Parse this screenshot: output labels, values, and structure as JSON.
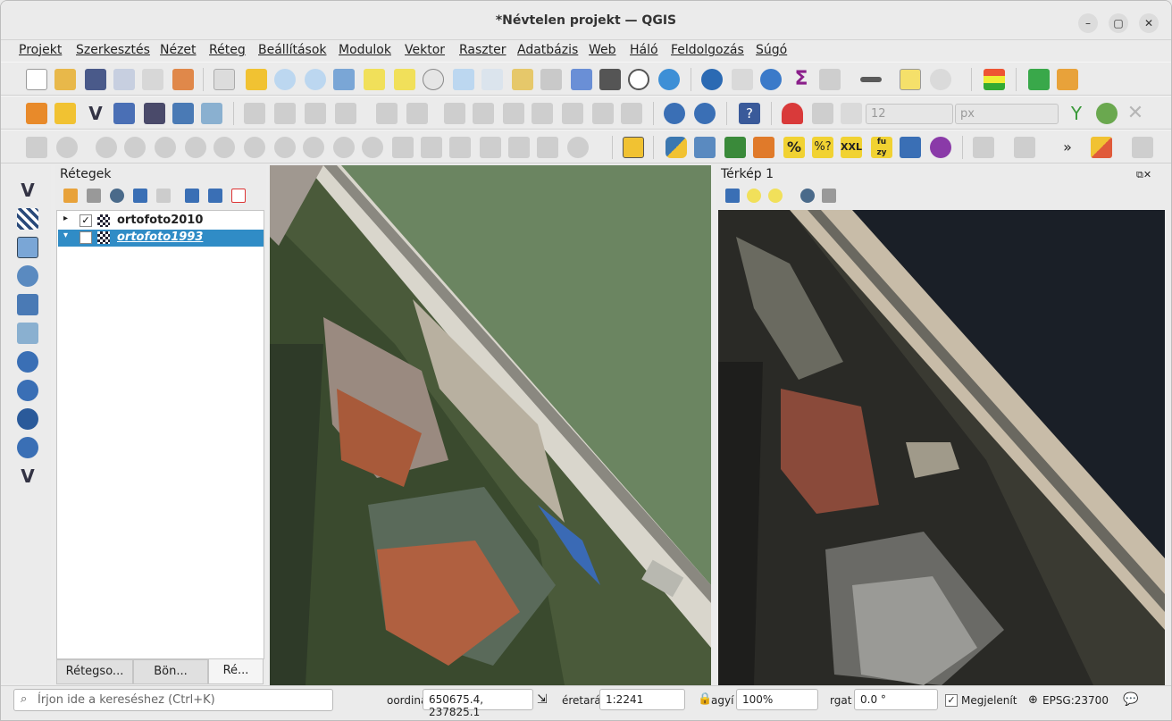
{
  "window": {
    "title": "*Névtelen projekt — QGIS"
  },
  "menu": [
    "Projekt",
    "Szerkesztés",
    "Nézet",
    "Réteg",
    "Beállítások",
    "Modulok",
    "Vektor",
    "Raszter",
    "Adatbázis",
    "Web",
    "Háló",
    "Feldolgozás",
    "Súgó"
  ],
  "digitize": {
    "size_value": "12",
    "unit_value": "px"
  },
  "layers_panel": {
    "title": "Rétegek",
    "layers": [
      {
        "name": "ortofoto2010",
        "checked": true,
        "checkmark": "✓",
        "selected": false
      },
      {
        "name": "ortofoto1993",
        "checked": false,
        "checkmark": "",
        "selected": true
      }
    ],
    "tabs": [
      "Rétegso...",
      "Bön...",
      "Ré..."
    ]
  },
  "map2": {
    "title": "Térkép 1"
  },
  "status": {
    "search_placeholder": "Írjon ide a kereséshez (Ctrl+K)",
    "coord_label": "oordiná",
    "coord_value": "650675.4, 237825.1",
    "scale_label": "éretará",
    "scale_value": "1:2241",
    "magnifier_label": "agyí",
    "magnifier_value": "100%",
    "rotation_label": "rgat",
    "rotation_value": "0.0 °",
    "render_label": "Megjelenít",
    "crs": "EPSG:23700"
  },
  "colors": {
    "selection": "#308cc6",
    "river_2010": "#6b8561",
    "river_1993": "#1a1f27"
  }
}
